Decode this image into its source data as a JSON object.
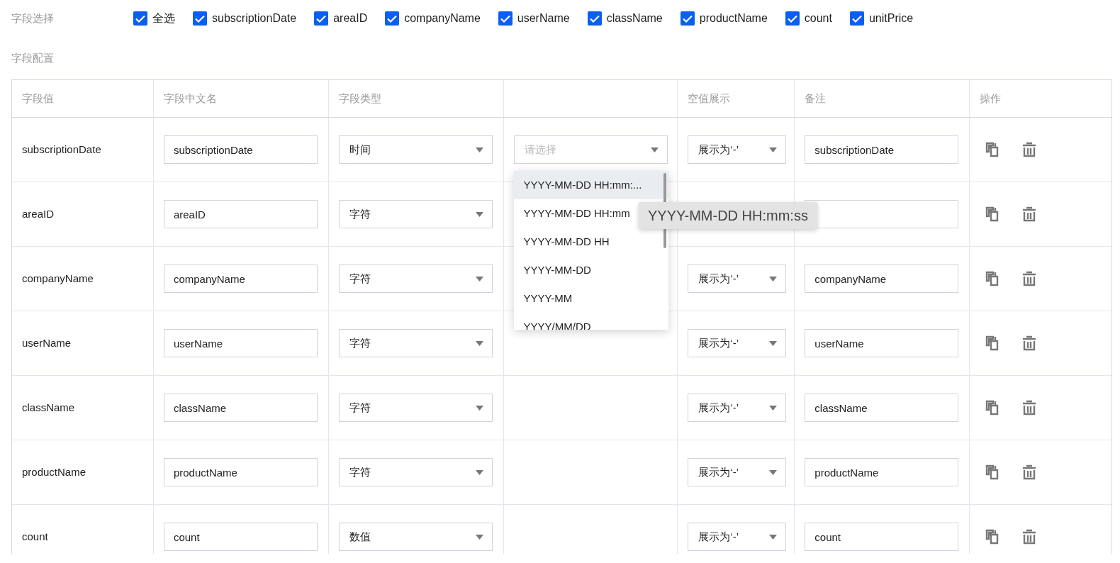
{
  "field_select": {
    "label": "字段选择",
    "items": [
      {
        "label": "全选",
        "checked": true
      },
      {
        "label": "subscriptionDate",
        "checked": true
      },
      {
        "label": "areaID",
        "checked": true
      },
      {
        "label": "companyName",
        "checked": true
      },
      {
        "label": "userName",
        "checked": true
      },
      {
        "label": "className",
        "checked": true
      },
      {
        "label": "productName",
        "checked": true
      },
      {
        "label": "count",
        "checked": true
      },
      {
        "label": "unitPrice",
        "checked": true
      }
    ]
  },
  "field_config": {
    "label": "字段配置",
    "columns": [
      "字段值",
      "字段中文名",
      "字段类型",
      "空值展示",
      "备注",
      "操作"
    ],
    "rows": [
      {
        "field": "subscriptionDate",
        "name_cn": "subscriptionDate",
        "type": "时间",
        "format": {
          "placeholder": "请选择",
          "open": true
        },
        "null_display": "展示为‘-’",
        "remark": "subscriptionDate"
      },
      {
        "field": "areaID",
        "name_cn": "areaID",
        "type": "字符"
      },
      {
        "field": "companyName",
        "name_cn": "companyName",
        "type": "字符",
        "null_display": "展示为‘-’",
        "remark": "companyName"
      },
      {
        "field": "userName",
        "name_cn": "userName",
        "type": "字符",
        "null_display": "展示为‘-’",
        "remark": "userName"
      },
      {
        "field": "className",
        "name_cn": "className",
        "type": "字符",
        "null_display": "展示为‘-’",
        "remark": "className"
      },
      {
        "field": "productName",
        "name_cn": "productName",
        "type": "字符",
        "null_display": "展示为‘-’",
        "remark": "productName"
      },
      {
        "field": "count",
        "name_cn": "count",
        "type": "数值",
        "null_display": "展示为‘-’",
        "remark": "count"
      }
    ]
  },
  "format_menu": {
    "options": [
      {
        "label": "YYYY-MM-DD HH:mm:...",
        "selected": true
      },
      {
        "label": "YYYY-MM-DD HH:mm",
        "selected": false
      },
      {
        "label": "YYYY-MM-DD HH",
        "selected": false
      },
      {
        "label": "YYYY-MM-DD",
        "selected": false
      },
      {
        "label": "YYYY-MM",
        "selected": false
      },
      {
        "label": "YYYY/MM/DD",
        "selected": false
      }
    ],
    "tooltip": "YYYY-MM-DD HH:mm:ss"
  }
}
